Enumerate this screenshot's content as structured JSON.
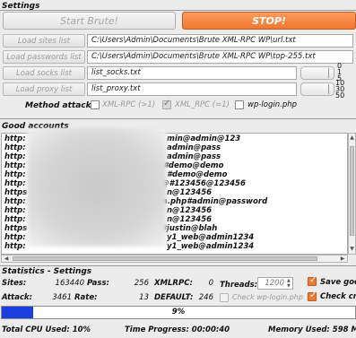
{
  "settings": {
    "title": "Settings",
    "start_label": "Start Brute!",
    "stop_label": "STOP!",
    "rows": [
      {
        "button": "Load sites list",
        "value": "C:\\Users\\Admin\\Documents\\Brute XML-RPC WP\\url.txt"
      },
      {
        "button": "Load passwords list",
        "value": "C:\\Users\\Admin\\Documents\\Brute XML-RPC WP\\top-255.txt"
      },
      {
        "button": "Load socks list",
        "value": "list_socks.txt"
      },
      {
        "button": "Load proxy list",
        "value": "list_proxy.txt"
      }
    ],
    "socks_slider_ticks": [
      "0",
      "1",
      "5"
    ],
    "proxy_slider_ticks": [
      "10",
      "30",
      "50"
    ],
    "method_label": "Method attack :",
    "methods": [
      {
        "label": "XML-RPC (>1)",
        "checked": false
      },
      {
        "label": "XML_RPC (=1)",
        "checked": true
      },
      {
        "label": "wp-login.php",
        "checked": false
      }
    ]
  },
  "good_accounts": {
    "title": "Good accounts",
    "lines": [
      {
        "prefix": "http:",
        "suffix": "min@admin@123"
      },
      {
        "prefix": "http:",
        "suffix": "admin@pass"
      },
      {
        "prefix": "http:",
        "suffix": "admin@pass"
      },
      {
        "prefix": "http:",
        "suffix": "#demo@demo"
      },
      {
        "prefix": "http:",
        "suffix": "#demo@demo"
      },
      {
        "prefix": "http:",
        "suffix": "@#123456@123456"
      },
      {
        "prefix": "https",
        "suffix": "n@123456"
      },
      {
        "prefix": "http:",
        "suffix": "a.php#admin@password"
      },
      {
        "prefix": "http:",
        "suffix": "n@123456"
      },
      {
        "prefix": "http:",
        "suffix": "n@123456"
      },
      {
        "prefix": "https",
        "suffix": "#justin@blah"
      },
      {
        "prefix": "http:",
        "suffix": "y1_web@admin1234"
      },
      {
        "prefix": "http:",
        "suffix": "y1_web@admin1234"
      }
    ]
  },
  "statistics": {
    "title": "Statistics - Settings",
    "sites_label": "Sites:",
    "sites_value": "163440",
    "pass_label": "Pass:",
    "pass_value": "256",
    "xmlrpc_label": "XMLRPC:",
    "xmlrpc_value": "0",
    "threads_label": "Threads:",
    "threads_value": "1200",
    "save_good_label": "Save goo",
    "attack_label": "Attack:",
    "attack_value": "3461",
    "rate_label": "Rate:",
    "rate_value": "13",
    "default_label": "DEFAULT:",
    "default_value": "246",
    "check_wp_login_label": "Check wp-login.php",
    "check_cms_label": "Check cm"
  },
  "progress": {
    "percent_text": "9%",
    "fraction": 0.09
  },
  "status_bar": {
    "cpu": "Total CPU Used: 10%",
    "time": "Time Progress: 00:00:40",
    "memory": "Memory Used: 598 MB"
  },
  "colors": {
    "stop_button": "#f0782f",
    "progress_fill": "#1d3fe0",
    "checkbox_checked": "#f07a2f"
  }
}
